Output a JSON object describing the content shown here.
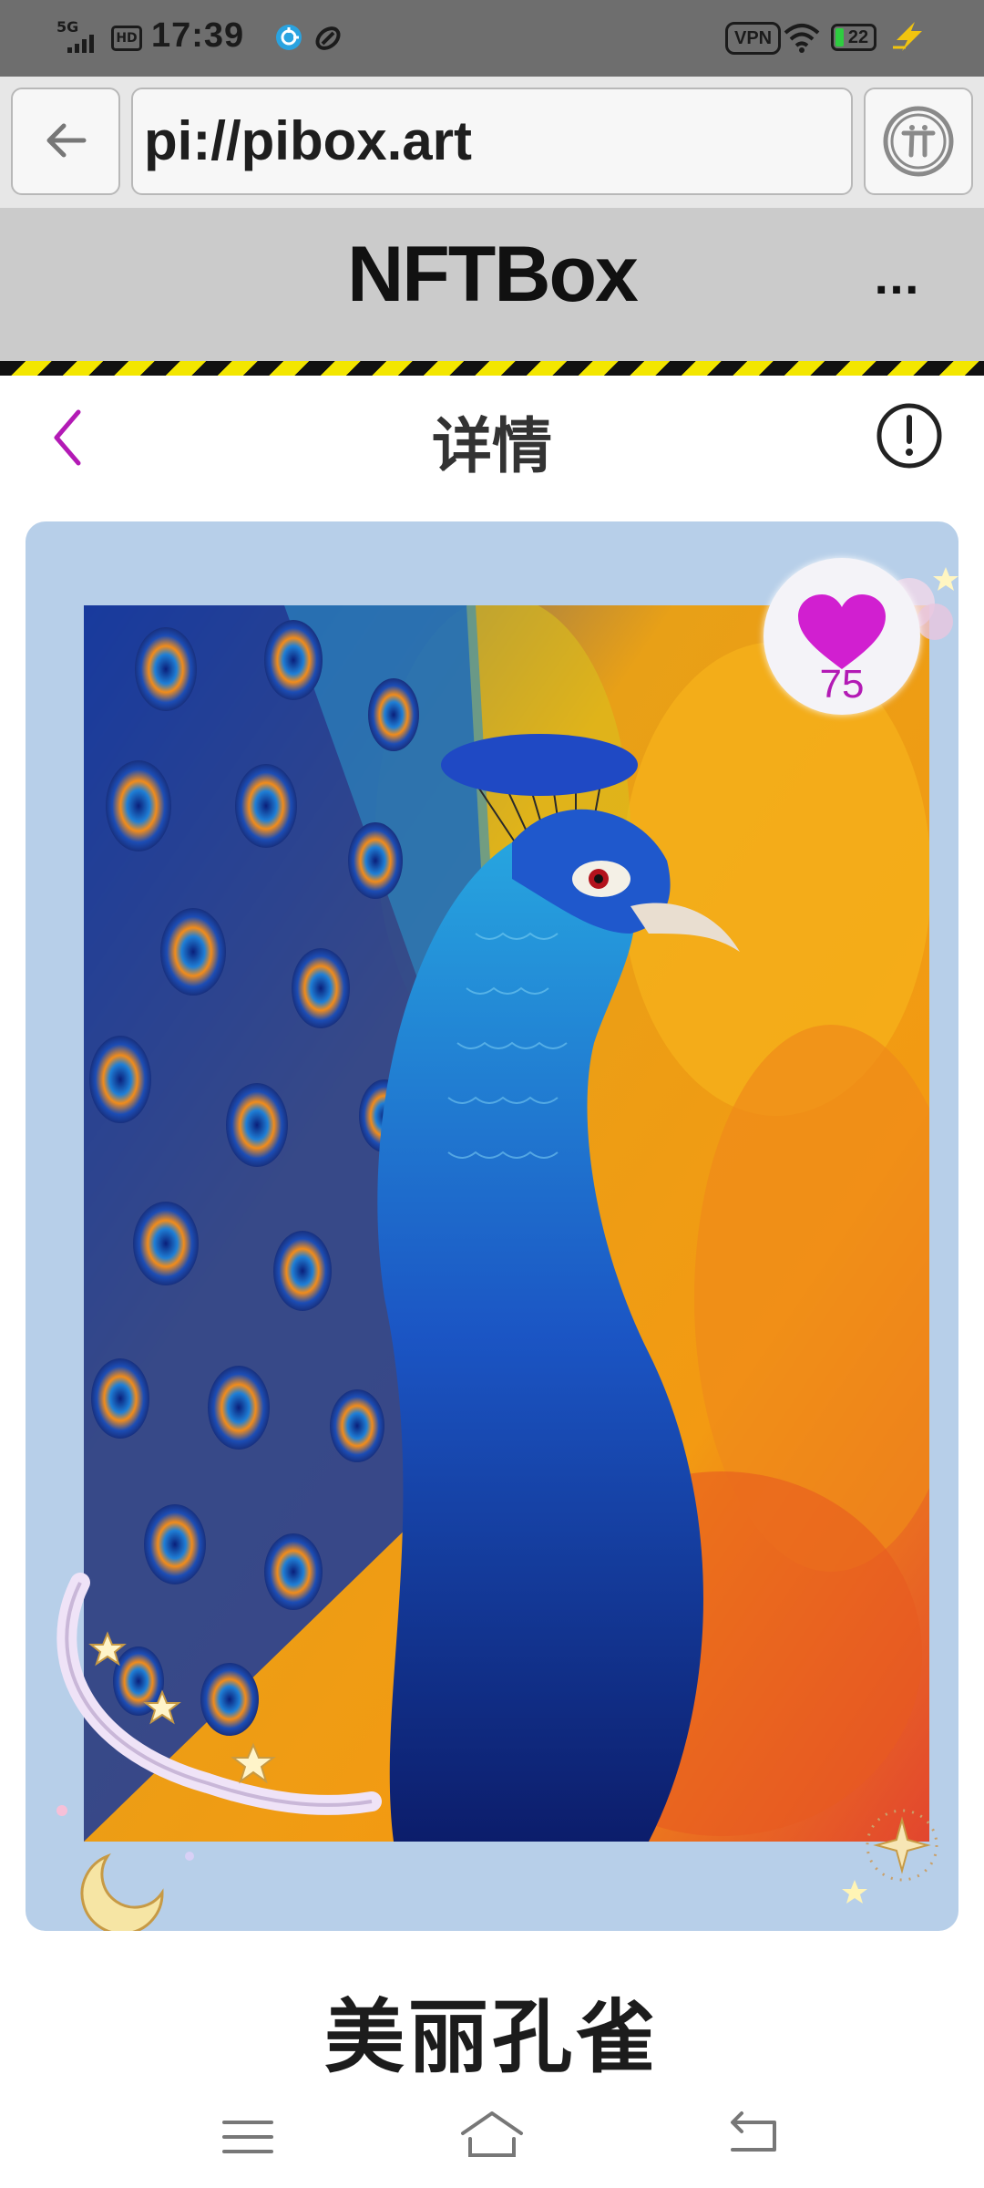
{
  "status_bar": {
    "network": "5G",
    "hd": "HD",
    "time": "17:39",
    "vpn": "VPN",
    "battery": "22",
    "icons": [
      "signal-icon",
      "hd-icon",
      "app-notification-icon",
      "link-notification-icon",
      "wifi-icon",
      "battery-icon",
      "charging-bolt-icon"
    ]
  },
  "browser": {
    "url": "pi://pibox.art",
    "back_icon": "arrow-left-icon",
    "pi_icon": "pi-network-icon"
  },
  "app_header": {
    "title": "NFTBox",
    "more_label": "...",
    "hazard_colors": [
      "#111111",
      "#f3e600"
    ]
  },
  "page_header": {
    "title": "详情",
    "back_icon": "chevron-left-icon",
    "info_icon": "info-icon",
    "accent": "#b31ab5"
  },
  "nft": {
    "name": "美丽孔雀",
    "likes": "75",
    "card_color": "#b7cfe9",
    "heart_color": "#d11fd0"
  },
  "nav_bar": {
    "icons": [
      "menu-icon",
      "home-icon",
      "back-icon"
    ]
  }
}
